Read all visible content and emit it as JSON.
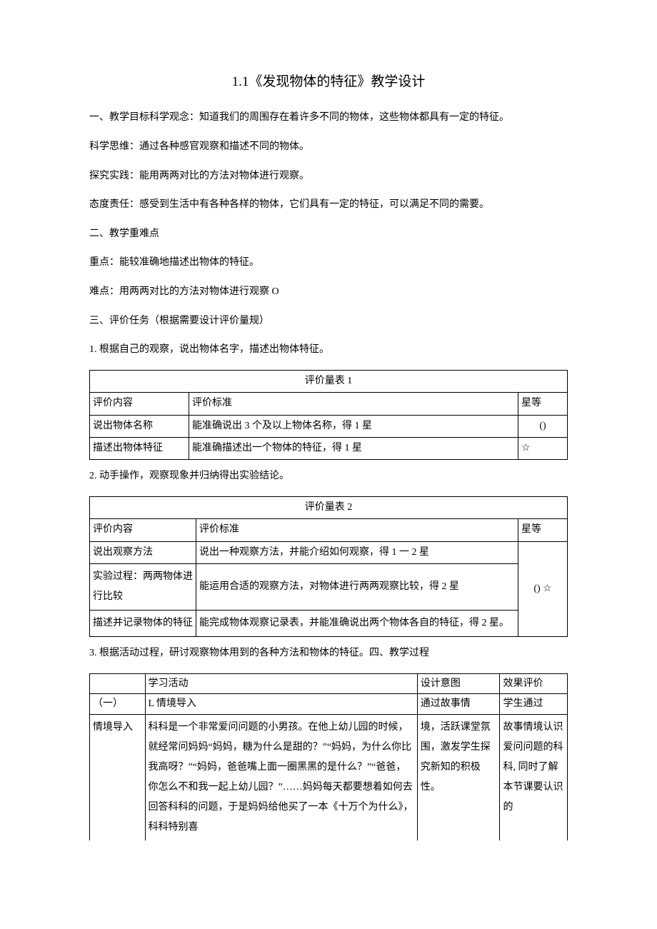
{
  "title": "1.1《发现物体的特征》教学设计",
  "paras": {
    "p1": "一、教学目标科学观念：知道我们的周围存在着许多不同的物体，这些物体都具有一定的特征。",
    "p2": "科学思维：通过各种感官观察和描述不同的物体。",
    "p3": "探究实践：能用两两对比的方法对物体进行观察。",
    "p4": "态度责任：感受到生活中有各种各样的物体，它们具有一定的特征，可以满足不同的需要。",
    "p5": "二、教学重难点",
    "p6": "重点：能较准确地描述出物体的特征。",
    "p7": "难点：用两两对比的方法对物体进行观察 O",
    "p8": "三、评价任务（根据需要设计评价量规）",
    "p9": "1. 根据自己的观察，说出物体名字，描述出物体特征。",
    "p10": "2. 动手操作，观察现象并归纳得出实验结论。",
    "p11": "3. 根据活动过程，研讨观察物体用到的各种方法和物体的特征。四、教学过程"
  },
  "table1": {
    "caption": "评价量表 1",
    "headers": {
      "c1": "评价内容",
      "c2": "评价标准",
      "c3": "星等"
    },
    "rows": [
      {
        "c1": "说出物体名称",
        "c2": "能准确说出 3 个及以上物体名称，得 1 星",
        "c3": "()"
      },
      {
        "c1": "描述出物体特征",
        "c2": "能准确描述出一个物体的特征，得 1 星",
        "c3": "☆"
      }
    ]
  },
  "table2": {
    "caption": "评价量表 2",
    "headers": {
      "c1": "评价内容",
      "c2": "评价标准",
      "c3": "星等"
    },
    "rows": [
      {
        "c1": "说出观察方法",
        "c2": "说出一种观察方法，并能介绍如何观察，得 1 一 2 星"
      },
      {
        "c1": "实验过程：两两物体进行比较",
        "c2": "能运用合适的观察方法，对物体进行两两观察比较，得 2 星"
      },
      {
        "c1": "描述并记录物体的特征",
        "c2": "能完成物体观察记录表，并能准确说出两个物体各自的特征，得 2 星。"
      }
    ],
    "star": "() ☆"
  },
  "lesson": {
    "headers": {
      "c1": "",
      "c2": "学习活动",
      "c3": "设计意图",
      "c4": "效果评价"
    },
    "row1": {
      "c1_a": "（一）",
      "c1_b": "情境导入",
      "c2_a_title": "L 情境导入",
      "c2_b": "科科是一个非常爱问问题的小男孩。在他上幼儿园的时候，就经常问妈妈“妈妈，糖为什么是甜的？”“妈妈，为什么你比我高呀？”“妈妈，爸爸嘴上面一圈黑黑的是什么？”“爸爸，你怎么不和我一起上幼儿园？”……妈妈每天都要想着如何去回答科科的问题，于是妈妈给他买了一本《十万个为什么》，科科特别喜",
      "c3_a": "通过故事情",
      "c3_b": "境，活跃课堂氛围，激发学生探究新知的积极性。",
      "c4_a": "学生通过",
      "c4_b": "故事情境认识爱问问题的科科, 同时了解本节课要认识的"
    }
  }
}
